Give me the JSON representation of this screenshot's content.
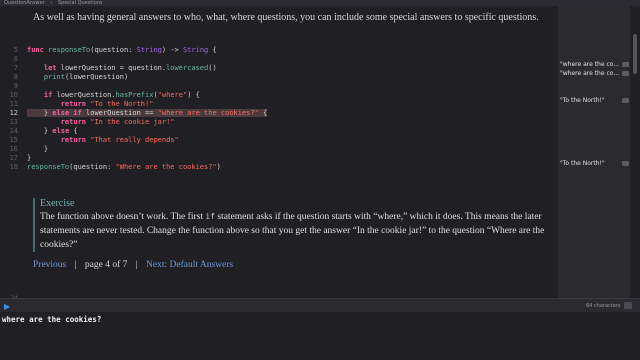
{
  "breadcrumb": {
    "project": "QuestionAnswer",
    "page": "Special Questions"
  },
  "intro": "As well as having general answers to who, what, where questions, you can include some special answers to specific questions.",
  "code": {
    "numbers": [
      "5",
      "6",
      "7",
      "8",
      "9",
      "10",
      "11",
      "12",
      "13",
      "14",
      "15",
      "16",
      "17",
      "18"
    ],
    "current_line": "12"
  },
  "results": {
    "r7": "\"where are the co...",
    "r8": "\"where are the co...",
    "r11": "\"To the North!\"",
    "r18": "\"To the North!\""
  },
  "exercise": {
    "title": "Exercise",
    "text_a": "The function above doesn’t work. The first ",
    "code_word": "if",
    "text_b": " statement asks if the question starts with “where,” which it does. This means the later statements are never tested. Change the function above so that you get the answer “In the cookie jar!” to the question “Where are the cookies?”"
  },
  "pager": {
    "previous": "Previous",
    "page": "page 4 of 7",
    "next": "Next: Default Answers"
  },
  "editor_last_line": "24",
  "console": {
    "char_count": "64 characters",
    "output": "where are the cookies?"
  },
  "colors": {
    "keyword": "#fc5fa3",
    "string": "#fc6a5d",
    "function": "#67b7a4",
    "type": "#a167e6",
    "link": "#6d9bdc",
    "run": "#3c8cf0"
  }
}
